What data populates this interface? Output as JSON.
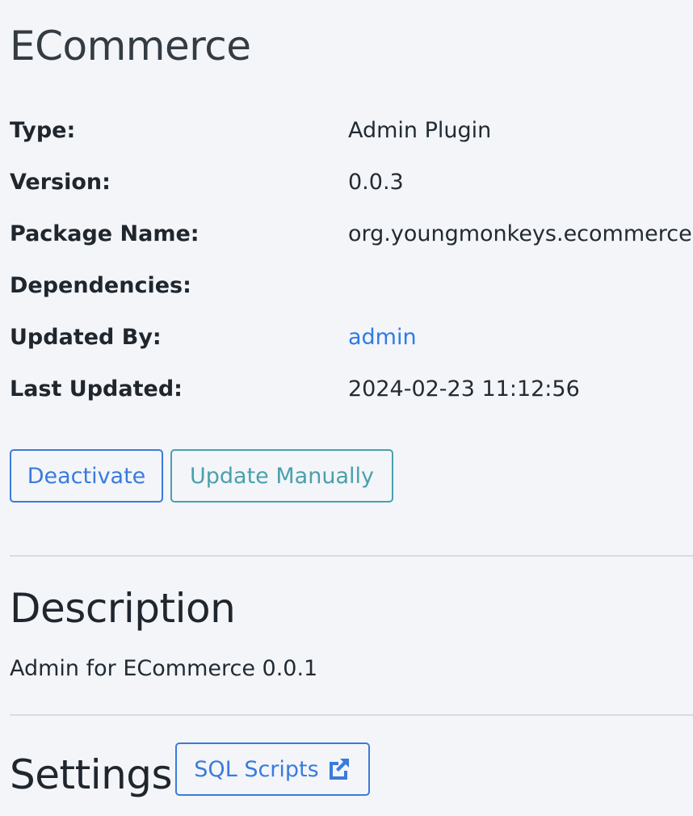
{
  "page": {
    "title": "ECommerce"
  },
  "info": {
    "type_label": "Type:",
    "type_value": "Admin Plugin",
    "version_label": "Version:",
    "version_value": "0.0.3",
    "package_label": "Package Name:",
    "package_value": "org.youngmonkeys.ecommerce",
    "dependencies_label": "Dependencies:",
    "dependencies_value": "",
    "updated_by_label": "Updated By:",
    "updated_by_value": "admin",
    "last_updated_label": "Last Updated:",
    "last_updated_value": "2024-02-23 11:12:56"
  },
  "actions": {
    "deactivate_label": "Deactivate",
    "update_manually_label": "Update Manually"
  },
  "description": {
    "title": "Description",
    "text": "Admin for ECommerce 0.0.1"
  },
  "settings": {
    "title": "Settings",
    "sql_scripts_label": "SQL Scripts",
    "sql_scripts_icon": "external-link-icon"
  },
  "colors": {
    "primary": "#3a7bdc",
    "info": "#4aa0ac",
    "link": "#2f7be5",
    "background": "#f3f5f9"
  }
}
